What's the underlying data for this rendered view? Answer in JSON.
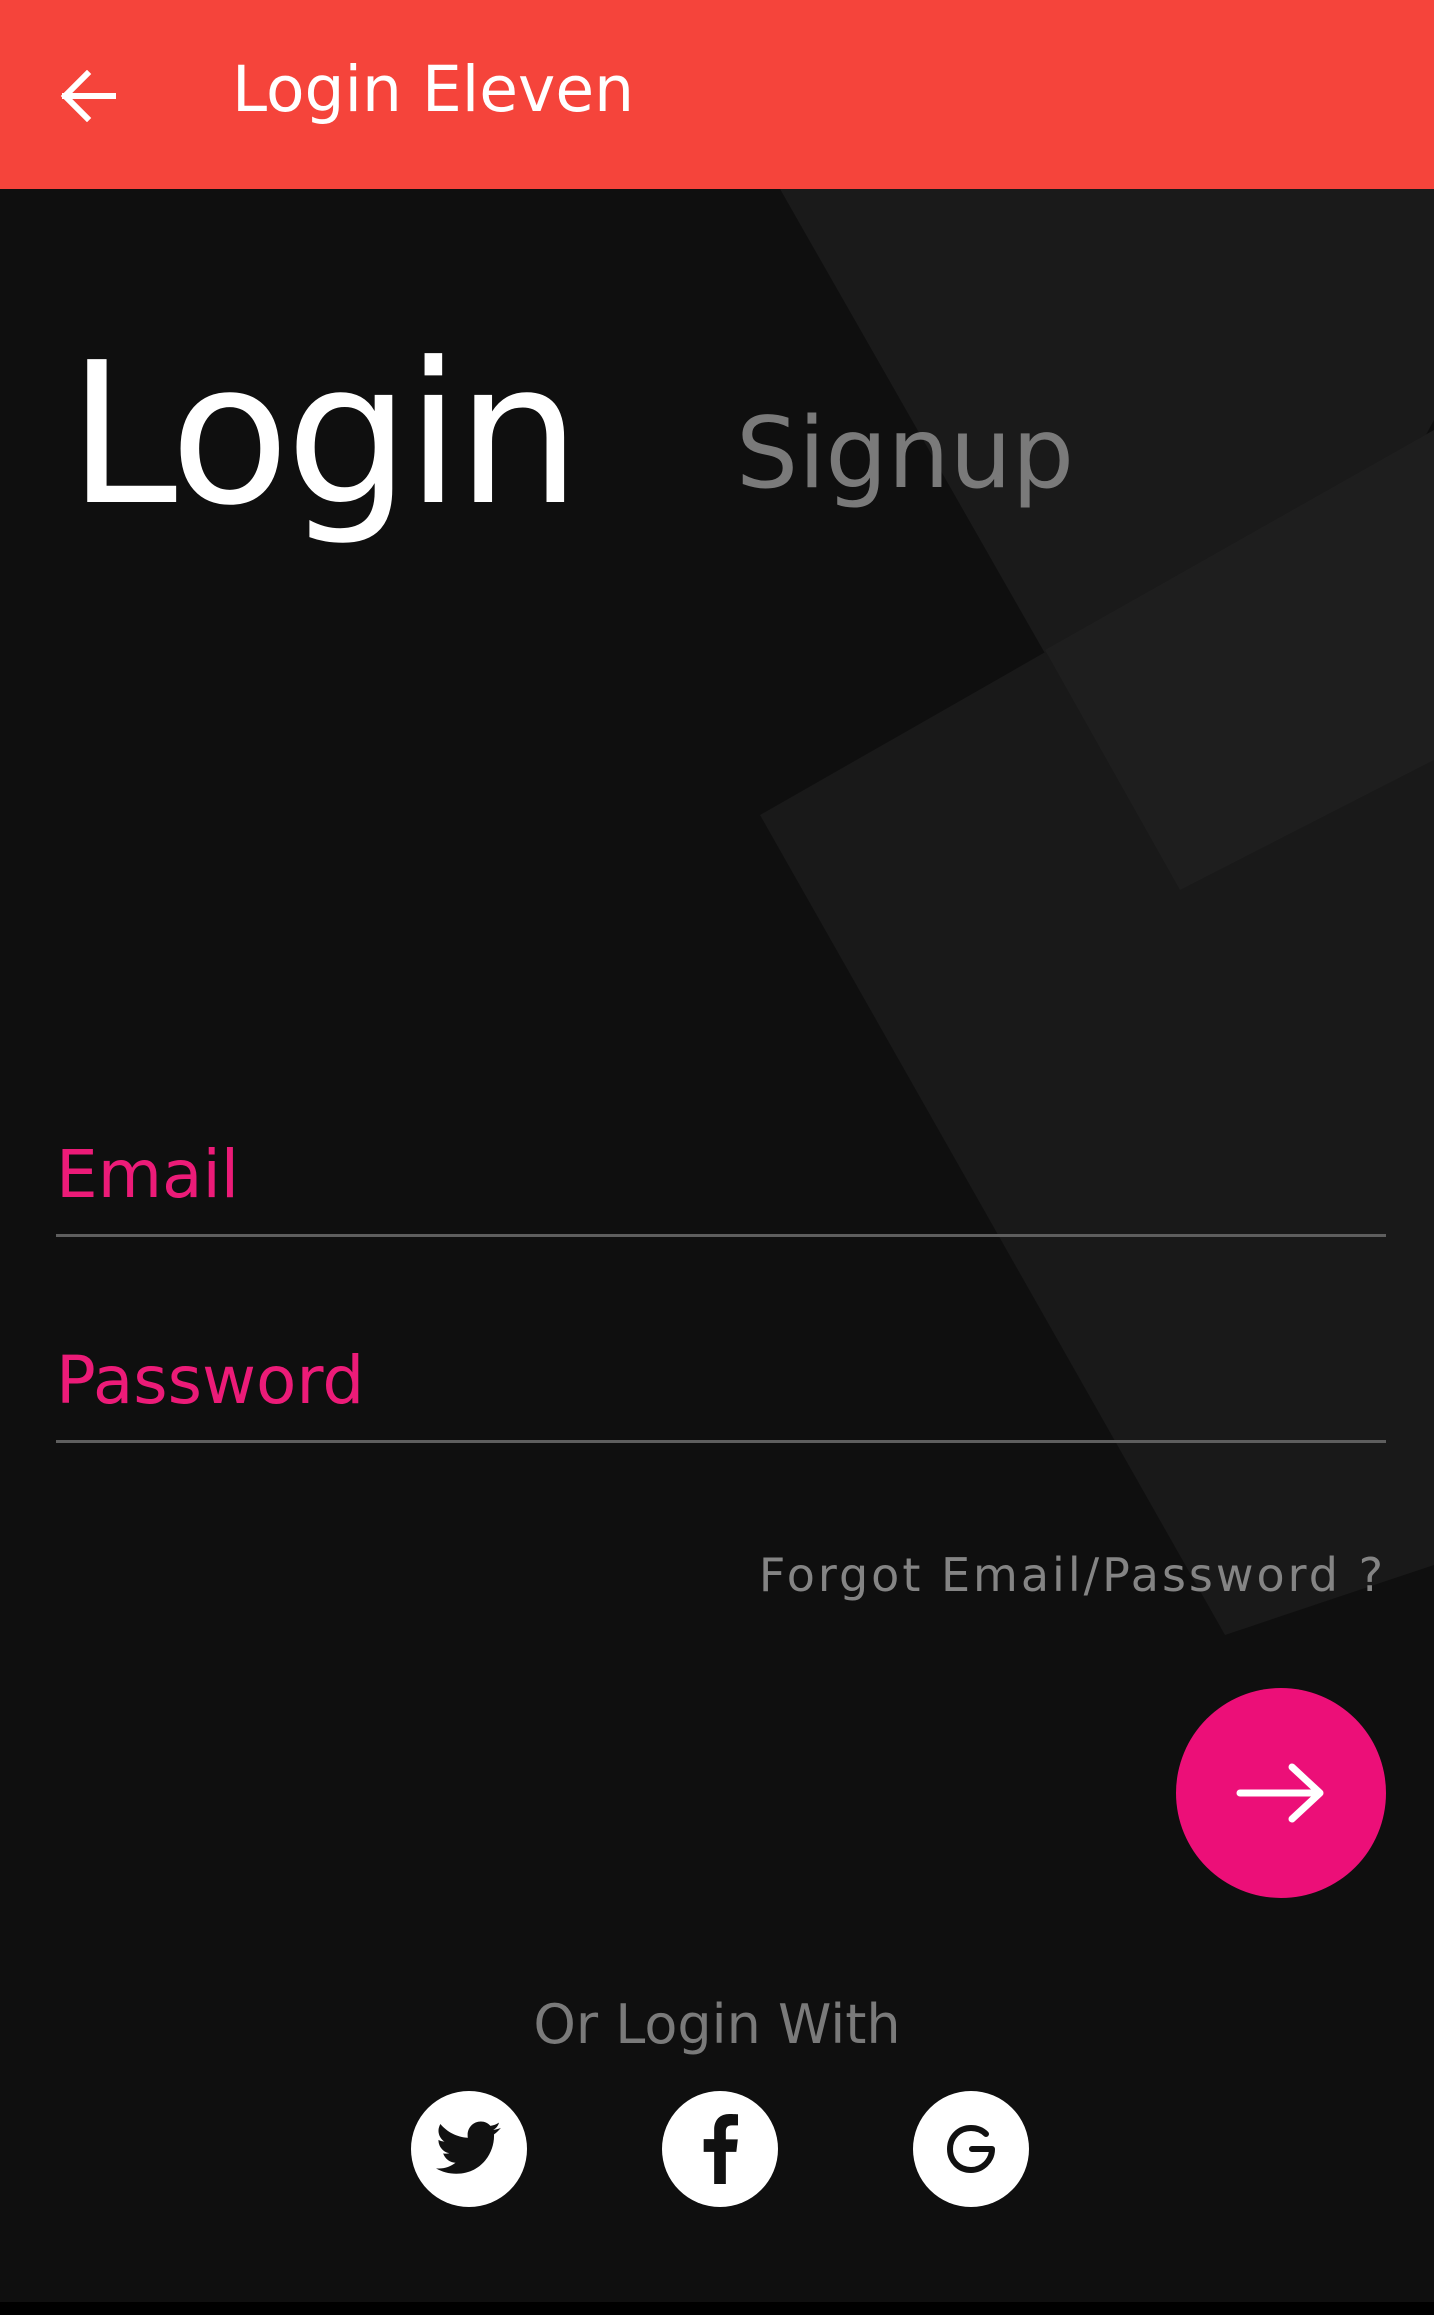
{
  "appbar": {
    "title": "Login Eleven",
    "back_icon": "arrow-left-icon",
    "background_color": "#f5443b"
  },
  "tabs": {
    "login_label": "Login",
    "signup_label": "Signup"
  },
  "form": {
    "email_placeholder": "Email",
    "email_value": "",
    "password_placeholder": "Password",
    "password_value": "",
    "forgot_label": "Forgot Email/Password ?",
    "submit_icon": "arrow-right-icon"
  },
  "social": {
    "heading": "Or Login With",
    "providers": [
      "twitter-icon",
      "facebook-icon",
      "google-icon"
    ]
  },
  "colors": {
    "accent": "#ec0f78",
    "background": "#0f0f0f",
    "muted_text": "#7a7a7a"
  }
}
